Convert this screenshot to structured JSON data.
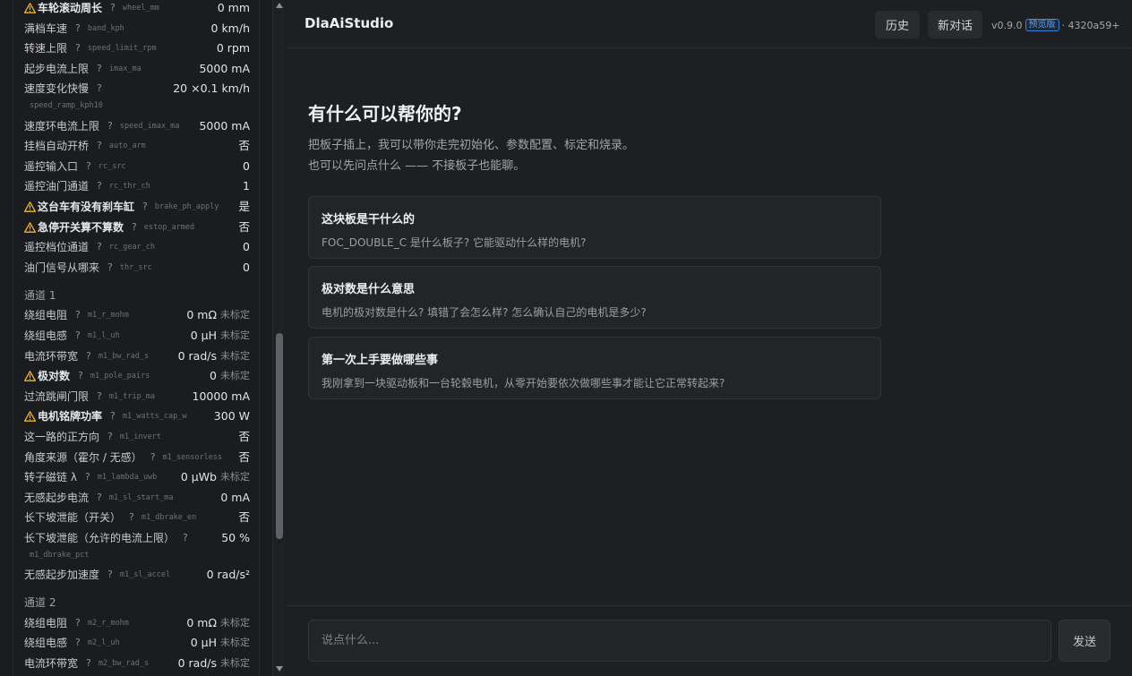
{
  "params_top": [
    {
      "label": "车轮滚动周长",
      "key": "wheel_mm",
      "value": "0 mm",
      "warn": true
    },
    {
      "label": "满档车速",
      "key": "band_kph",
      "value": "0 km/h",
      "warn": false
    },
    {
      "label": "转速上限",
      "key": "speed_limit_rpm",
      "value": "0 rpm",
      "warn": false
    },
    {
      "label": "起步电流上限",
      "key": "imax_ma",
      "value": "5000 mA",
      "warn": false
    },
    {
      "label": "速度变化快慢",
      "key": "speed_ramp_kph10",
      "value": "20 ×0.1 km/h",
      "warn": false,
      "tall": true
    },
    {
      "label": "速度环电流上限",
      "key": "speed_imax_ma",
      "value": "5000 mA",
      "warn": false
    },
    {
      "label": "挂档自动开桥",
      "key": "auto_arm",
      "value": "否",
      "warn": false
    },
    {
      "label": "遥控输入口",
      "key": "rc_src",
      "value": "0",
      "warn": false
    },
    {
      "label": "遥控油门通道",
      "key": "rc_thr_ch",
      "value": "1",
      "warn": false
    },
    {
      "label": "这台车有没有刹车缸",
      "key": "brake_ph_apply",
      "value": "是",
      "warn": true
    },
    {
      "label": "急停开关算不算数",
      "key": "estop_armed",
      "value": "否",
      "warn": true
    },
    {
      "label": "遥控档位通道",
      "key": "rc_gear_ch",
      "value": "0",
      "warn": false
    },
    {
      "label": "油门信号从哪来",
      "key": "thr_src",
      "value": "0",
      "warn": false
    }
  ],
  "section1": "通道 1",
  "params_ch1": [
    {
      "label": "绕组电阻",
      "key": "m1_r_mohm",
      "value": "0 mΩ",
      "uncal": "未标定",
      "warn": false
    },
    {
      "label": "绕组电感",
      "key": "m1_l_uh",
      "value": "0 µH",
      "uncal": "未标定",
      "warn": false
    },
    {
      "label": "电流环带宽",
      "key": "m1_bw_rad_s",
      "value": "0 rad/s",
      "uncal": "未标定",
      "warn": false
    },
    {
      "label": "极对数",
      "key": "m1_pole_pairs",
      "value": "0",
      "uncal": "未标定",
      "warn": true
    },
    {
      "label": "过流跳闸门限",
      "key": "m1_trip_ma",
      "value": "10000 mA",
      "warn": false
    },
    {
      "label": "电机铭牌功率",
      "key": "m1_watts_cap_w",
      "value": "300 W",
      "warn": true
    },
    {
      "label": "这一路的正方向",
      "key": "m1_invert",
      "value": "否",
      "warn": false
    },
    {
      "label": "角度来源（霍尔 / 无感）",
      "key": "m1_sensorless",
      "value": "否",
      "warn": false
    },
    {
      "label": "转子磁链 λ",
      "key": "m1_lambda_uwb",
      "value": "0 µWb",
      "uncal": "未标定",
      "warn": false
    },
    {
      "label": "无感起步电流",
      "key": "m1_sl_start_ma",
      "value": "0 mA",
      "warn": false
    },
    {
      "label": "长下坡泄能（开关）",
      "key": "m1_dbrake_en",
      "value": "否",
      "warn": false
    },
    {
      "label": "长下坡泄能（允许的电流上限）",
      "key": "m1_dbrake_pct",
      "value": "50 %",
      "warn": false,
      "tall": true
    },
    {
      "label": "无感起步加速度",
      "key": "m1_sl_accel",
      "value": "0 rad/s²",
      "warn": false
    }
  ],
  "section2": "通道 2",
  "params_ch2": [
    {
      "label": "绕组电阻",
      "key": "m2_r_mohm",
      "value": "0 mΩ",
      "uncal": "未标定",
      "warn": false
    },
    {
      "label": "绕组电感",
      "key": "m2_l_uh",
      "value": "0 µH",
      "uncal": "未标定",
      "warn": false
    },
    {
      "label": "电流环带宽",
      "key": "m2_bw_rad_s",
      "value": "0 rad/s",
      "uncal": "未标定",
      "warn": false
    }
  ],
  "help_mark": "?",
  "header": {
    "brand": "DlaAiStudio",
    "history": "历史",
    "new_chat": "新对话",
    "version": "v0.9.0",
    "badge": "预览版",
    "commit": "· 4320a59+"
  },
  "hero": {
    "title": "有什么可以帮你的?",
    "line1": "把板子插上，我可以带你走完初始化、参数配置、标定和烧录。",
    "line2": "也可以先问点什么 —— 不接板子也能聊。"
  },
  "cards": [
    {
      "title": "这块板是干什么的",
      "desc": "FOC_DOUBLE_C 是什么板子? 它能驱动什么样的电机?"
    },
    {
      "title": "极对数是什么意思",
      "desc": "电机的极对数是什么? 填错了会怎么样? 怎么确认自己的电机是多少?"
    },
    {
      "title": "第一次上手要做哪些事",
      "desc": "我刚拿到一块驱动板和一台轮毂电机，从零开始要依次做哪些事才能让它正常转起来?"
    }
  ],
  "input": {
    "placeholder": "说点什么..."
  },
  "send": "发送",
  "colors": {
    "warn": "#f2b233",
    "badge": "#3b82d6",
    "background": "#1b1c1f"
  }
}
